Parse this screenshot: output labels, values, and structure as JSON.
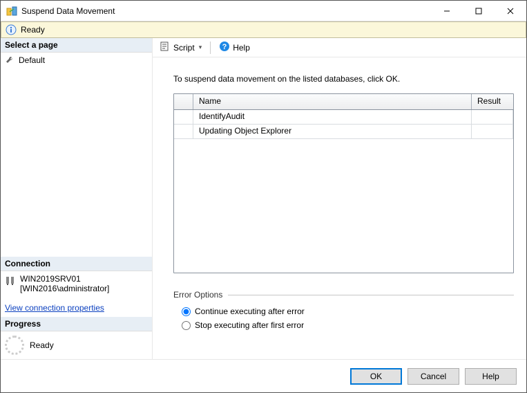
{
  "window": {
    "title": "Suspend Data Movement"
  },
  "ready_bar": {
    "label": "Ready"
  },
  "left": {
    "select_page_header": "Select a page",
    "pages": [
      {
        "label": "Default"
      }
    ],
    "connection_header": "Connection",
    "server": "WIN2019SRV01",
    "login": "[WIN2016\\administrator]",
    "view_conn_link": "View connection properties",
    "progress_header": "Progress",
    "progress_label": "Ready"
  },
  "toolbar": {
    "script_label": "Script",
    "help_label": "Help"
  },
  "main": {
    "instruction": "To suspend data movement on the listed databases, click OK.",
    "columns": {
      "name": "Name",
      "result": "Result"
    },
    "rows": [
      {
        "name": "IdentifyAudit",
        "result": ""
      },
      {
        "name": "Updating Object Explorer",
        "result": ""
      }
    ]
  },
  "error_options": {
    "legend": "Error Options",
    "continue_label": "Continue executing after error",
    "stop_label": "Stop executing after first error",
    "selected": "continue"
  },
  "footer": {
    "ok": "OK",
    "cancel": "Cancel",
    "help": "Help"
  }
}
